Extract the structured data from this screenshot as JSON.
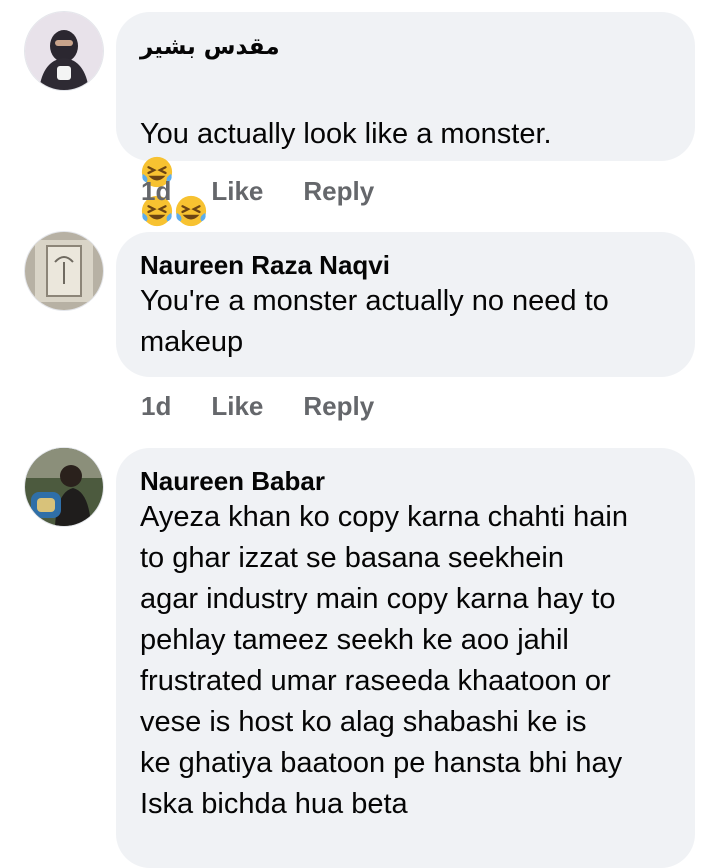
{
  "comments": [
    {
      "author": "مقدس بشير",
      "text_line1": "You actually look like a monster.",
      "time": "1d",
      "like_label": "Like",
      "reply_label": "Reply"
    },
    {
      "author": "Naureen Raza Naqvi",
      "text": "You're a monster actually no need to\nmakeup",
      "time": "1d",
      "like_label": "Like",
      "reply_label": "Reply"
    },
    {
      "author": "Naureen Babar",
      "text": "Ayeza khan ko copy karna chahti hain\nto ghar izzat se basana seekhein\nagar industry main copy karna hay to\npehlay tameez seekh ke aoo jahil\nfrustrated umar raseeda khaatoon or\nvese is host ko alag shabashi ke is\nke ghatiya baatoon pe hansta bhi hay\nIska bichda hua beta"
    }
  ],
  "icons": {
    "comment_emoji": "rolling-on-floor-laughing-emoji"
  },
  "colors": {
    "bubble": "#f0f2f5",
    "secondary_text": "#65676b",
    "emoji_face": "#f7c231"
  }
}
